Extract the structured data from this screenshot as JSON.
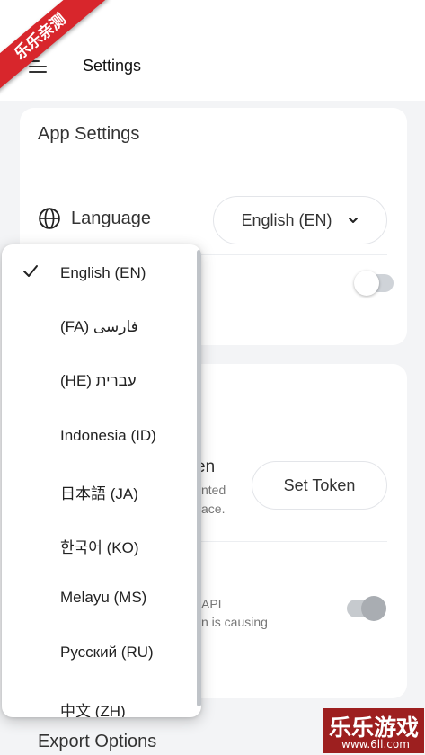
{
  "appbar": {
    "title": "Settings"
  },
  "watermark": {
    "corner": "乐乐亲测",
    "logo": "乐乐游戏",
    "site": "www.6ll.com"
  },
  "app_settings": {
    "title": "App Settings",
    "language_label": "Language",
    "language_value": "English (EN)"
  },
  "hidden_card": {
    "token_title_fragment": "en",
    "token_sub_line1": "nted",
    "token_sub_line2": "ace.",
    "set_token_label": "Set Token",
    "api_sub_line1": "API",
    "api_sub_line2": "n is causing"
  },
  "export": {
    "title": "Export Options"
  },
  "language_menu": {
    "selected_index": 0,
    "items": [
      {
        "label": "English (EN)"
      },
      {
        "label": "(FA) فارسی"
      },
      {
        "label": "(HE) עברית"
      },
      {
        "label": "Indonesia (ID)"
      },
      {
        "label": "日本語 (JA)"
      },
      {
        "label": "한국어 (KO)"
      },
      {
        "label": "Melayu (MS)"
      },
      {
        "label": "Русский (RU)"
      },
      {
        "label": "中文 (ZH)"
      }
    ]
  },
  "icons": {
    "menu": "hamburger-menu-icon",
    "language": "globe-icon",
    "dropdown": "chevron-down-icon",
    "selected": "checkmark-icon"
  }
}
